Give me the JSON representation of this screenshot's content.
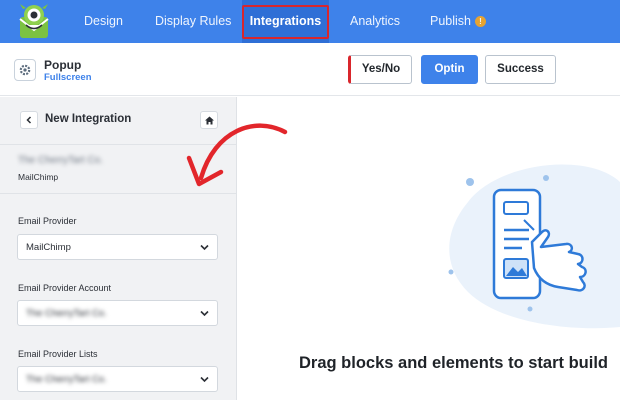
{
  "nav": {
    "items": [
      {
        "label": "Design"
      },
      {
        "label": "Display Rules"
      },
      {
        "label": "Integrations"
      },
      {
        "label": "Analytics"
      },
      {
        "label": "Publish"
      }
    ],
    "active": "Integrations",
    "publish_badge": "!",
    "highlight_color": "#d9262c",
    "bar_color": "#3e82ea"
  },
  "campaign": {
    "name": "Popup",
    "type": "Fullscreen"
  },
  "views": {
    "yesno": "Yes/No",
    "optin": "Optin",
    "success": "Success",
    "active": "Optin"
  },
  "sidebar": {
    "title": "New Integration",
    "card": {
      "account": "The CherryTart Co.",
      "provider": "MailChimp"
    },
    "fields": [
      {
        "label": "Email Provider",
        "value": "MailChimp"
      },
      {
        "label": "Email Provider Account",
        "value": "The CherryTart Co."
      },
      {
        "label": "Email Provider Lists",
        "value": "The CherryTart Co."
      }
    ]
  },
  "canvas": {
    "message": "Drag blocks and elements to start build"
  },
  "icons": {
    "logo": "optinmonster-logo",
    "gear": "gear-icon",
    "back": "chevron-left-icon",
    "home": "home-icon",
    "select": "chevron-down-icon",
    "arrow": "curved-arrow-annotation",
    "illustration": "drag-hand-illustration"
  }
}
